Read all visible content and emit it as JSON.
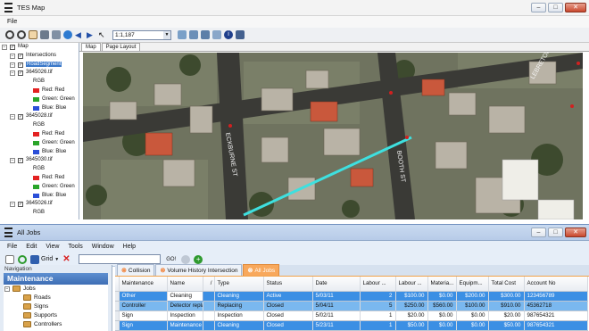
{
  "tes_map": {
    "title": "TES Map",
    "menu": [
      "File"
    ],
    "scale_value": "1:1,187",
    "tabs": [
      "Map",
      "Page Layout"
    ],
    "layers": [
      {
        "type": "group",
        "label": "Map"
      },
      {
        "type": "layer",
        "label": "Intersections"
      },
      {
        "type": "layer",
        "label": "RoadSegment"
      },
      {
        "type": "layer",
        "label": "3645026.tif"
      },
      {
        "type": "sub",
        "label": "RGB"
      },
      {
        "type": "band",
        "label": "Red:   Red",
        "color": "#e32222"
      },
      {
        "type": "band",
        "label": "Green: Green",
        "color": "#2aa52a"
      },
      {
        "type": "band",
        "label": "Blue:  Blue",
        "color": "#2b4fd8"
      },
      {
        "type": "layer",
        "label": "3645028.tif"
      },
      {
        "type": "sub",
        "label": "RGB"
      },
      {
        "type": "band",
        "label": "Red:   Red",
        "color": "#e32222"
      },
      {
        "type": "band",
        "label": "Green: Green",
        "color": "#2aa52a"
      },
      {
        "type": "band",
        "label": "Blue:  Blue",
        "color": "#2b4fd8"
      },
      {
        "type": "layer",
        "label": "3645030.tif"
      },
      {
        "type": "sub",
        "label": "RGB"
      },
      {
        "type": "band",
        "label": "Red:   Red",
        "color": "#e32222"
      },
      {
        "type": "band",
        "label": "Green: Green",
        "color": "#2aa52a"
      },
      {
        "type": "band",
        "label": "Blue:  Blue",
        "color": "#2b4fd8"
      },
      {
        "type": "layer",
        "label": "3645026.tif"
      },
      {
        "type": "sub",
        "label": "RGB"
      }
    ],
    "street_labels": [
      "ECKBURNE ST",
      "BOOTH ST",
      "LEBRETON ST"
    ],
    "highlight_color": "#3ee0df"
  },
  "all_jobs": {
    "title": "All Jobs",
    "menu": [
      "File",
      "Edit",
      "View",
      "Tools",
      "Window",
      "Help"
    ],
    "grid_button": "Grid",
    "go_label": "GO!",
    "navigation_label": "Navigation",
    "section_title": "Maintenance",
    "nav_items": [
      {
        "label": "Jobs",
        "level": 0
      },
      {
        "label": "Roads",
        "level": 1
      },
      {
        "label": "Signs",
        "level": 1
      },
      {
        "label": "Supports",
        "level": 1
      },
      {
        "label": "Controllers",
        "level": 1
      }
    ],
    "tabs": [
      {
        "label": "Collision",
        "active": false
      },
      {
        "label": "Volume History Intersection",
        "active": false
      },
      {
        "label": "All Jobs",
        "active": true
      }
    ],
    "columns": [
      "Maintenance",
      "Name",
      "/",
      "Type",
      "Status",
      "Date",
      "Labour ...",
      "Labour ...",
      "Materia...",
      "Equipm...",
      "Total Cost",
      "Account No"
    ],
    "rows": [
      {
        "cells": [
          "Other",
          "Cleaning",
          "",
          "Cleaning",
          "Active",
          "5/03/11",
          "2",
          "$100.00",
          "$0.00",
          "$200.00",
          "$300.00",
          "123456789"
        ],
        "state": "selected"
      },
      {
        "cells": [
          "Controller",
          "Detector replac...",
          "",
          "Replacing",
          "Closed",
          "5/04/11",
          "5",
          "$250.00",
          "$560.00",
          "$100.00",
          "$910.00",
          "45362718"
        ],
        "state": "selected-light"
      },
      {
        "cells": [
          "Sign",
          "Inspection",
          "",
          "Inspection",
          "Closed",
          "5/02/11",
          "1",
          "$20.00",
          "$0.00",
          "$0.00",
          "$20.00",
          "987654321"
        ],
        "state": "normal"
      },
      {
        "cells": [
          "Sign",
          "Maintenance",
          "",
          "Cleaning",
          "Closed",
          "5/23/11",
          "1",
          "$50.00",
          "$0.00",
          "$0.00",
          "$50.00",
          "987654321"
        ],
        "state": "selected"
      }
    ]
  }
}
